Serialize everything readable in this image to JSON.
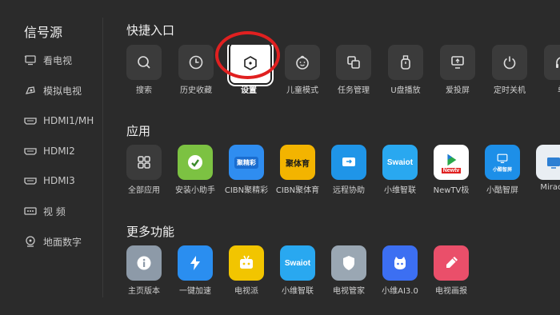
{
  "sidebar": {
    "title": "信号源",
    "items": [
      {
        "label": "看电视",
        "icon": "tv-icon"
      },
      {
        "label": "模拟电视",
        "icon": "antenna-icon"
      },
      {
        "label": "HDMI1/MH",
        "icon": "hdmi-icon"
      },
      {
        "label": "HDMI2",
        "icon": "hdmi-icon"
      },
      {
        "label": "HDMI3",
        "icon": "hdmi-icon"
      },
      {
        "label": "视    频",
        "icon": "video-icon"
      },
      {
        "label": "地面数字",
        "icon": "dtv-icon"
      }
    ]
  },
  "quick_access": {
    "title": "快捷入口",
    "selected": "设置",
    "items": [
      {
        "label": "搜索",
        "icon": "search-icon"
      },
      {
        "label": "历史收藏",
        "icon": "clock-icon"
      },
      {
        "label": "设置",
        "icon": "settings-icon"
      },
      {
        "label": "儿童模式",
        "icon": "child-face-icon"
      },
      {
        "label": "任务管理",
        "icon": "task-manager-icon"
      },
      {
        "label": "U盘播放",
        "icon": "usb-icon"
      },
      {
        "label": "爱投屏",
        "icon": "cast-icon"
      },
      {
        "label": "定时关机",
        "icon": "power-icon"
      },
      {
        "label": "单",
        "icon": "headphone-icon"
      }
    ]
  },
  "apps": {
    "title": "应用",
    "items": [
      {
        "label": "全部应用",
        "icon": "grid-icon"
      },
      {
        "label": "安装小助手",
        "icon": "install-helper-icon"
      },
      {
        "label": "CIBN聚精彩",
        "icon": "cibn-jujingcai-icon",
        "badge": "聚精彩"
      },
      {
        "label": "CIBN聚体育",
        "icon": "cibn-sports-icon",
        "badge": "聚体育"
      },
      {
        "label": "远程协助",
        "icon": "remote-assist-icon"
      },
      {
        "label": "小维智联",
        "icon": "swaiot-icon",
        "badge": "Swaiot"
      },
      {
        "label": "NewTV极",
        "icon": "newtv-icon",
        "badge": "Newtv"
      },
      {
        "label": "小酷智屏",
        "icon": "xiaoku-icon",
        "badge": "小酷智屏"
      },
      {
        "label": "Miraca",
        "icon": "miracast-icon"
      }
    ]
  },
  "more": {
    "title": "更多功能",
    "items": [
      {
        "label": "主页版本",
        "icon": "info-icon"
      },
      {
        "label": "一键加速",
        "icon": "lightning-icon"
      },
      {
        "label": "电视派",
        "icon": "tv-pie-icon"
      },
      {
        "label": "小维智联",
        "icon": "swaiot-icon",
        "badge": "Swaiot"
      },
      {
        "label": "电视管家",
        "icon": "shield-icon"
      },
      {
        "label": "小维AI3.0",
        "icon": "xiaowei-ai-icon"
      },
      {
        "label": "电视画报",
        "icon": "pencil-icon"
      }
    ]
  },
  "colors": {
    "background": "#2b2b2b",
    "tile": "#3b3b3b",
    "highlight_ring": "#e02020"
  }
}
